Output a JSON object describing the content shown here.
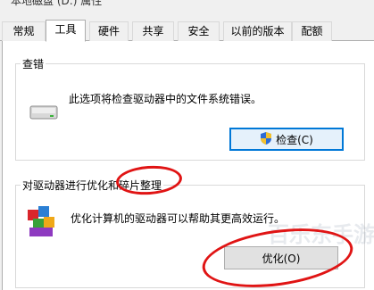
{
  "window": {
    "title": "本地磁盘 (D:) 属性"
  },
  "tabs": [
    {
      "label": "常规"
    },
    {
      "label": "工具"
    },
    {
      "label": "硬件"
    },
    {
      "label": "共享"
    },
    {
      "label": "安全"
    },
    {
      "label": "以前的版本"
    },
    {
      "label": "配额"
    }
  ],
  "error_check": {
    "title": "查错",
    "description": "此选项将检查驱动器中的文件系统错误。",
    "button_label": "检查(C)",
    "icon": "drive-icon"
  },
  "optimize": {
    "title": "对驱动器进行优化和碎片整理",
    "description": "优化计算机的驱动器可以帮助其更高效运行。",
    "button_label": "优化(O)",
    "icon": "defrag-icon"
  },
  "annotations": {
    "color": "#e01414"
  },
  "watermark": {
    "text": "百乐东手游"
  }
}
